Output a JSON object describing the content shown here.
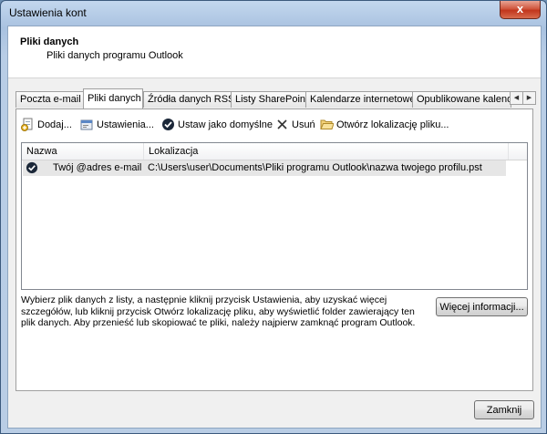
{
  "window": {
    "title": "Ustawienia kont",
    "close_glyph": "x"
  },
  "header": {
    "title": "Pliki danych",
    "subtitle": "Pliki danych programu Outlook"
  },
  "tabs": [
    {
      "label": "Poczta e-mail"
    },
    {
      "label": "Pliki danych"
    },
    {
      "label": "Źródła danych RSS"
    },
    {
      "label": "Listy SharePoint"
    },
    {
      "label": "Kalendarze internetowe"
    },
    {
      "label": "Opublikowane kalendarze"
    }
  ],
  "toolbar": {
    "add": "Dodaj...",
    "settings": "Ustawienia...",
    "set_default": "Ustaw jako domyślne",
    "remove": "Usuń",
    "open_location": "Otwórz lokalizację pliku..."
  },
  "list": {
    "columns": [
      "Nazwa",
      "Lokalizacja"
    ],
    "rows": [
      {
        "name": "Twój @adres e-mail",
        "location": "C:\\Users\\user\\Documents\\Pliki programu Outlook\\nazwa twojego profilu.pst",
        "default": true
      }
    ]
  },
  "footer": {
    "info": "Wybierz plik danych z listy, a następnie kliknij przycisk Ustawienia, aby uzyskać więcej szczegółów, lub kliknij przycisk Otwórz lokalizację pliku, aby wyświetlić folder zawierający ten plik danych. Aby przenieść lub skopiować te pliki, należy najpierw zamknąć program Outlook.",
    "more_info_button": "Więcej informacji...",
    "close_button": "Zamknij"
  },
  "colors": {
    "title_bar": "#b9cde5",
    "close_button": "#c1351c",
    "row_selected": "#e6e6e6"
  }
}
